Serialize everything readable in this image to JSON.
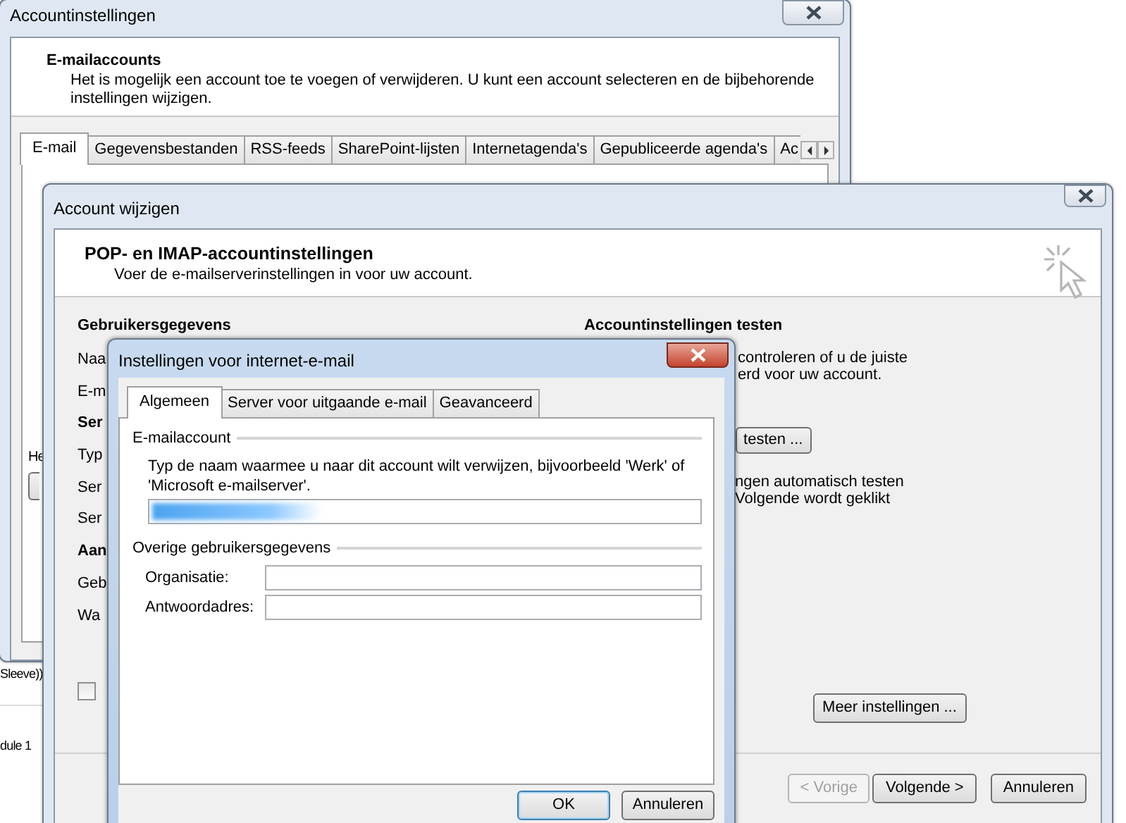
{
  "background_app": {
    "fragments": [
      "Sleeve))",
      "dule 1"
    ]
  },
  "account_settings_window": {
    "title": "Accountinstellingen",
    "heading": "E-mailaccounts",
    "description": "Het is mogelijk een account toe te voegen of verwijderen. U kunt een account selecteren en de bijbehorende instellingen wijzigen.",
    "tabs": [
      {
        "label": "E-mail",
        "selected": true
      },
      {
        "label": "Gegevensbestanden",
        "selected": false
      },
      {
        "label": "RSS-feeds",
        "selected": false
      },
      {
        "label": "SharePoint-lijsten",
        "selected": false
      },
      {
        "label": "Internetagenda's",
        "selected": false
      },
      {
        "label": "Gepubliceerde agenda's",
        "selected": false
      },
      {
        "label": "Ac",
        "selected": false
      }
    ],
    "label_fragment": "He"
  },
  "change_account_window": {
    "title": "Account wijzigen",
    "heading": "POP- en IMAP-accountinstellingen",
    "subheading": "Voer de e-mailserverinstellingen in voor uw account.",
    "user_info_heading": "Gebruikersgegevens",
    "left_labels": [
      {
        "text": "Naa",
        "kind": "label"
      },
      {
        "text": "E-m",
        "kind": "label"
      },
      {
        "text": "Ser",
        "kind": "heading"
      },
      {
        "text": "Typ",
        "kind": "label"
      },
      {
        "text": "Ser",
        "kind": "label"
      },
      {
        "text": "Ser",
        "kind": "label"
      },
      {
        "text": "Aan",
        "kind": "heading"
      },
      {
        "text": "Geb",
        "kind": "label"
      },
      {
        "text": "Wa",
        "kind": "label"
      }
    ],
    "remember_checked": false,
    "test_heading": "Accountinstellingen testen",
    "test_text": [
      "controleren of u de juiste",
      "erd voor uw account."
    ],
    "test_button": "testen ...",
    "auto_test_text": [
      "ngen automatisch testen",
      "Volgende wordt geklikt"
    ],
    "more_settings_button": "Meer instellingen ...",
    "buttons": [
      {
        "label": "< Vorige",
        "disabled": true
      },
      {
        "label": "Volgende >",
        "disabled": false
      },
      {
        "label": "Annuleren",
        "disabled": false
      }
    ]
  },
  "internet_email_dialog": {
    "title": "Instellingen voor internet-e-mail",
    "tabs": [
      {
        "label": "Algemeen",
        "selected": true
      },
      {
        "label": "Server voor uitgaande e-mail",
        "selected": false
      },
      {
        "label": "Geavanceerd",
        "selected": false
      }
    ],
    "account_group": "E-mailaccount",
    "account_hint": "Typ de naam waarmee u naar dit account wilt verwijzen, bijvoorbeeld 'Werk' of 'Microsoft e-mailserver'.",
    "other_group": "Overige gebruikersgegevens",
    "fields": [
      {
        "label": "Organisatie:"
      },
      {
        "label": "Antwoordadres:"
      }
    ],
    "buttons": [
      {
        "label": "OK",
        "default": true
      },
      {
        "label": "Annuleren",
        "default": false
      }
    ]
  }
}
